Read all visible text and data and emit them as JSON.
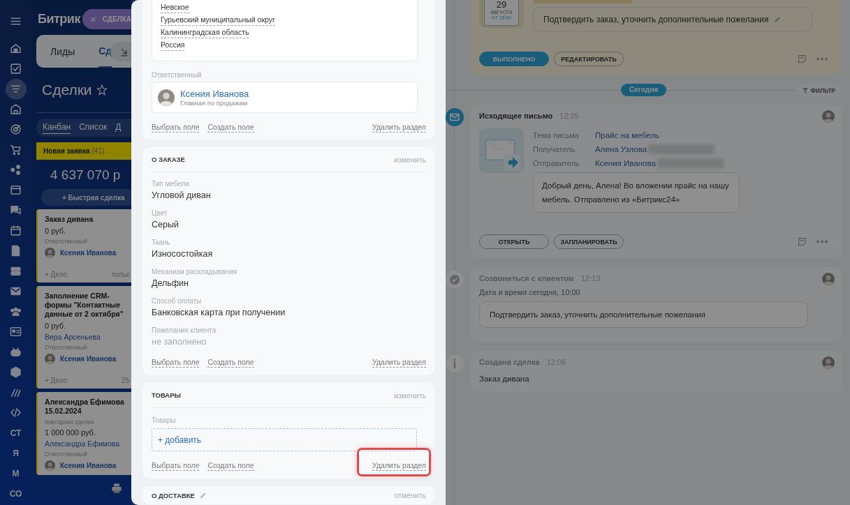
{
  "sidebar": {
    "items": [
      {
        "kind": "icon",
        "selected": false
      },
      {
        "kind": "icon",
        "selected": false
      },
      {
        "kind": "icon",
        "selected": false
      },
      {
        "kind": "icon",
        "selected": true
      },
      {
        "kind": "icon",
        "selected": false
      },
      {
        "kind": "icon",
        "selected": false
      },
      {
        "kind": "icon",
        "selected": false
      },
      {
        "kind": "icon",
        "selected": false
      },
      {
        "kind": "icon",
        "selected": false
      },
      {
        "kind": "icon",
        "selected": false
      },
      {
        "kind": "icon",
        "selected": false
      },
      {
        "kind": "icon",
        "selected": false
      },
      {
        "kind": "icon",
        "selected": false
      },
      {
        "kind": "icon",
        "selected": false
      },
      {
        "kind": "icon",
        "selected": false
      },
      {
        "kind": "icon",
        "selected": false
      },
      {
        "kind": "icon",
        "selected": false
      },
      {
        "kind": "icon",
        "selected": false
      },
      {
        "kind": "icon",
        "selected": false
      },
      {
        "kind": "icon",
        "selected": false
      },
      {
        "kind": "text",
        "label": "СТ",
        "selected": false
      },
      {
        "kind": "text",
        "label": "Я",
        "selected": false
      },
      {
        "kind": "text",
        "label": "М",
        "selected": false
      },
      {
        "kind": "text",
        "label": "СО",
        "selected": false
      }
    ]
  },
  "kanban": {
    "app_title": "Битрик",
    "tabs": [
      {
        "label": "Лиды",
        "selected": false
      },
      {
        "label": "Сд",
        "selected": true
      }
    ],
    "page_title": "Сделки",
    "views": [
      {
        "label": "Канбан",
        "selected": true
      },
      {
        "label": "Список",
        "selected": false
      },
      {
        "label": "Д",
        "selected": false
      }
    ],
    "stage": {
      "name": "Новая заявка",
      "count": "(41)",
      "sum": "4 637 070 р",
      "quick_add": "+ Быстрая сделка"
    },
    "cards": [
      {
        "title": "Заказ дивана",
        "amount": "0 руб.",
        "responsible_label": "Ответственный",
        "responsible": "Ксения Иванова",
        "add_task": "+ Дело",
        "extra": "тольк"
      },
      {
        "title": "Заполнение CRM-формы \"Контактные данные от 2 октября\"",
        "amount": "0 руб.",
        "client": "Вера Арсеньева",
        "responsible_label": "Ответственный",
        "responsible": "Ксения Иванова",
        "add_task": "+ Дело",
        "extra": "25"
      },
      {
        "title": "Александра Ефимова 15.02.2024",
        "note": "повторная сделка",
        "amount": "1 000 000 руб.",
        "client": "Александра Ефимова",
        "responsible_label": "Ответственный",
        "responsible": "Ксения Иванова"
      }
    ]
  },
  "slider_tab": {
    "close": "×",
    "label": "СДЕЛКА"
  },
  "details": {
    "address": [
      "Невское",
      "Гурьевский муниципальный округ",
      "Калининградская область",
      "Россия"
    ],
    "responsible": {
      "label": "Ответственный",
      "name": "Ксения Иванова",
      "role": "Главная по продажам"
    },
    "footer": {
      "links": [
        "Выбрать поле",
        "Создать поле"
      ],
      "delete": "Удалить раздел",
      "delete_highlighted": false
    }
  },
  "sections": [
    {
      "kind": "fields",
      "title": "О ЗАКАЗЕ",
      "action": "изменить",
      "editable": false,
      "fields": [
        {
          "label": "Тип мебели",
          "value": "Угловой диван",
          "empty": false
        },
        {
          "label": "Цвет",
          "value": "Серый",
          "empty": false
        },
        {
          "label": "Ткань",
          "value": "Износостойкая",
          "empty": false
        },
        {
          "label": "Механизм раскладывания",
          "value": "Дельфин",
          "empty": false
        },
        {
          "label": "Способ оплаты",
          "value": "Банковская карта при получении",
          "empty": false
        },
        {
          "label": "Пожелания клиента",
          "value": "не заполнено",
          "empty": true
        }
      ],
      "footer": {
        "links": [
          "Выбрать поле",
          "Создать поле"
        ],
        "delete": "Удалить раздел",
        "delete_highlighted": false
      }
    },
    {
      "kind": "products",
      "title": "ТОВАРЫ",
      "action": "изменить",
      "editable": false,
      "products": {
        "label": "Товары",
        "add": "+ добавить"
      },
      "footer": {
        "links": [
          "Выбрать поле",
          "Создать поле"
        ],
        "delete": "Удалить раздел",
        "delete_highlighted": true
      }
    },
    {
      "kind": "collapsed",
      "title": "О ДОСТАВКЕ",
      "action": "отменить",
      "editable": true
    }
  ],
  "timeline": {
    "task": {
      "day": "29",
      "month": "АВГУСТА",
      "time": "ЧТ 15:00",
      "comment": "Подтвердить заказ, уточнить дополнительные пожелания",
      "buttons": [
        {
          "label": "ВЫПОЛНЕНО",
          "primary": true
        },
        {
          "label": "РЕДАКТИРОВАТЬ",
          "primary": false
        }
      ]
    },
    "divider": {
      "label": "Сегодня",
      "filter": "ФИЛЬТР"
    },
    "events": [
      {
        "kind": "email",
        "title": "Исходящее письмо",
        "time": "12:25",
        "done": false,
        "fields": [
          {
            "label": "Тема письма",
            "value": "Прайс на мебель",
            "blurred_email": false
          },
          {
            "label": "Получатель",
            "value": "Алена Узлова",
            "blurred_email": true
          },
          {
            "label": "Отправитель",
            "value": "Ксения Иванова",
            "blurred_email": true
          }
        ],
        "message": "Добрый день, Алена! Во вложении прайс на нашу мебель. Отправлено из «Битрикс24»",
        "buttons": [
          "ОТКРЫТЬ",
          "ЗАПЛАНИРОВАТЬ"
        ]
      },
      {
        "kind": "call",
        "title": "Созвониться с клиентом",
        "time": "12:13",
        "done": true,
        "subtitle": "Дата и время сегодня, 10:00",
        "comment": "Подтвердить заказ, уточнить дополнительные пожелания"
      },
      {
        "kind": "created",
        "title": "Создана сделка",
        "time": "12:06",
        "done": true,
        "text": "Заказ дивана"
      }
    ]
  }
}
